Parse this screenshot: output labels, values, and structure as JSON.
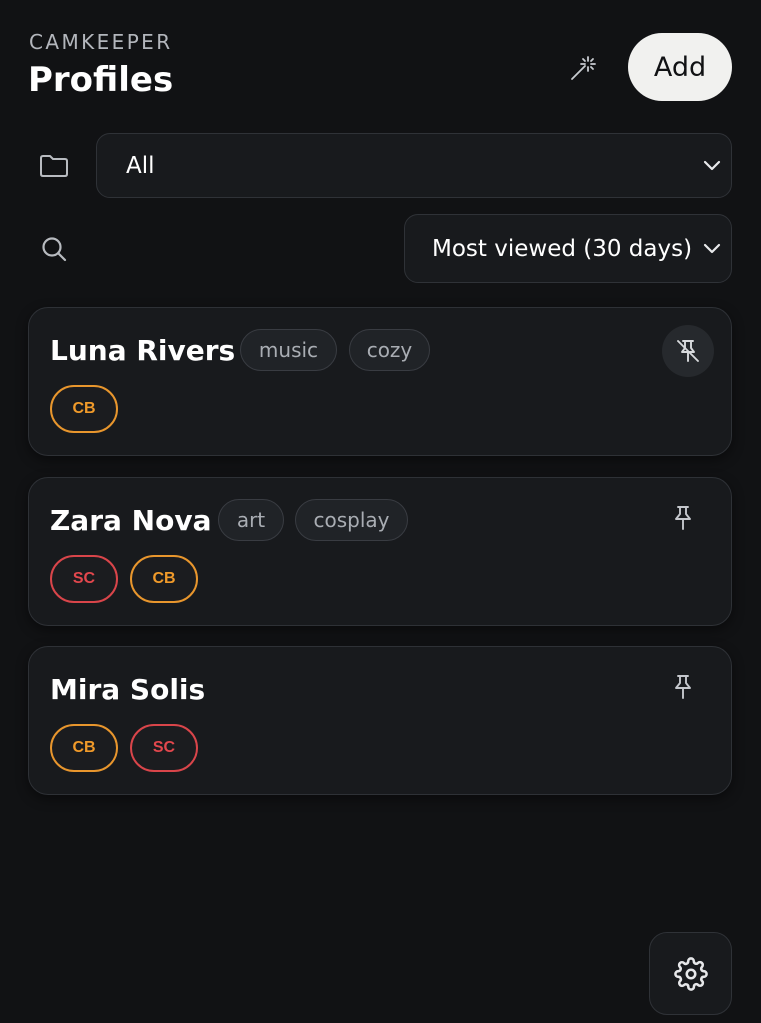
{
  "header": {
    "brand": "CAMKEEPER",
    "title": "Profiles",
    "add_label": "Add",
    "magic_icon": "magic-wand-icon"
  },
  "filters": {
    "folder_icon": "folder-icon",
    "folder_value": "All",
    "search_icon": "search-icon",
    "sort_value": "Most viewed (30 days)"
  },
  "profiles": [
    {
      "name": "Luna Rivers",
      "tags": [
        "music",
        "cozy"
      ],
      "platforms": [
        "CB"
      ],
      "pinned": true
    },
    {
      "name": "Zara Nova",
      "tags": [
        "art",
        "cosplay"
      ],
      "platforms": [
        "SC",
        "CB"
      ],
      "pinned": false
    },
    {
      "name": "Mira Solis",
      "tags": [],
      "platforms": [
        "CB",
        "SC"
      ],
      "pinned": false
    }
  ],
  "colors": {
    "background": "#111214",
    "card": "#181a1d",
    "cb": "#f09a2a",
    "sc": "#e2474d",
    "add_button": "#f1f1ef"
  },
  "settings_icon": "gear-icon"
}
